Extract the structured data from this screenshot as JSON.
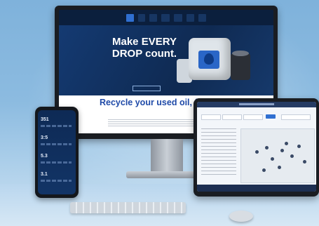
{
  "monitor": {
    "nav_items": [
      "",
      "",
      "",
      "",
      "",
      "",
      ""
    ],
    "hero_title": "Make EVERY DROP count.",
    "hero_button": "",
    "content_title": "Recycle your used oil, filters, containers & antifreeze"
  },
  "phone": {
    "stats": [
      "351",
      "3:5",
      "5.3",
      "3.1"
    ]
  },
  "colors": {
    "accent": "#2f6fd1",
    "hero_bg": "#0f2a52",
    "content_title": "#1f4aa8"
  }
}
